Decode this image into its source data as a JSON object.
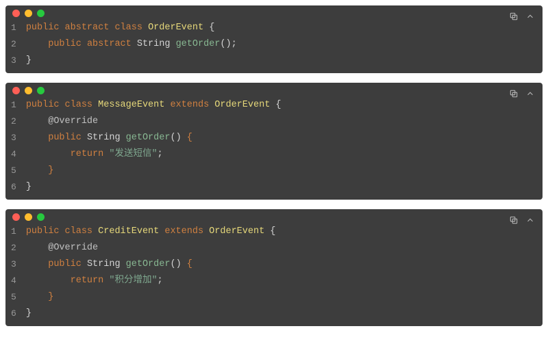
{
  "blocks": [
    {
      "id": "block-order-event",
      "lines": [
        [
          {
            "t": "public ",
            "c": "tok-key"
          },
          {
            "t": "abstract ",
            "c": "tok-key"
          },
          {
            "t": "class ",
            "c": "tok-key"
          },
          {
            "t": "OrderEvent ",
            "c": "tok-type"
          },
          {
            "t": "{",
            "c": "tok-punc"
          }
        ],
        [
          {
            "t": "    ",
            "c": ""
          },
          {
            "t": "public ",
            "c": "tok-key"
          },
          {
            "t": "abstract ",
            "c": "tok-key"
          },
          {
            "t": "String ",
            "c": "tok-punc"
          },
          {
            "t": "getOrder",
            "c": "tok-fn"
          },
          {
            "t": "();",
            "c": "tok-punc"
          }
        ],
        [
          {
            "t": "}",
            "c": "tok-punc"
          }
        ]
      ]
    },
    {
      "id": "block-message-event",
      "lines": [
        [
          {
            "t": "public ",
            "c": "tok-key"
          },
          {
            "t": "class ",
            "c": "tok-key"
          },
          {
            "t": "MessageEvent ",
            "c": "tok-type"
          },
          {
            "t": "extends ",
            "c": "tok-key"
          },
          {
            "t": "OrderEvent ",
            "c": "tok-type"
          },
          {
            "t": "{",
            "c": "tok-punc"
          }
        ],
        [
          {
            "t": "    ",
            "c": ""
          },
          {
            "t": "@Override",
            "c": "tok-anno"
          }
        ],
        [
          {
            "t": "    ",
            "c": ""
          },
          {
            "t": "public ",
            "c": "tok-key"
          },
          {
            "t": "String ",
            "c": "tok-punc"
          },
          {
            "t": "getOrder",
            "c": "tok-fn"
          },
          {
            "t": "() ",
            "c": "tok-punc"
          },
          {
            "t": "{",
            "c": "tok-brace"
          }
        ],
        [
          {
            "t": "        ",
            "c": ""
          },
          {
            "t": "return ",
            "c": "tok-key"
          },
          {
            "t": "\"发送短信\"",
            "c": "tok-str"
          },
          {
            "t": ";",
            "c": "tok-punc"
          }
        ],
        [
          {
            "t": "    ",
            "c": ""
          },
          {
            "t": "}",
            "c": "tok-brace"
          }
        ],
        [
          {
            "t": "}",
            "c": "tok-punc"
          }
        ]
      ]
    },
    {
      "id": "block-credit-event",
      "lines": [
        [
          {
            "t": "public ",
            "c": "tok-key"
          },
          {
            "t": "class ",
            "c": "tok-key"
          },
          {
            "t": "CreditEvent ",
            "c": "tok-type"
          },
          {
            "t": "extends ",
            "c": "tok-key"
          },
          {
            "t": "OrderEvent ",
            "c": "tok-type"
          },
          {
            "t": "{",
            "c": "tok-punc"
          }
        ],
        [
          {
            "t": "    ",
            "c": ""
          },
          {
            "t": "@Override",
            "c": "tok-anno"
          }
        ],
        [
          {
            "t": "    ",
            "c": ""
          },
          {
            "t": "public ",
            "c": "tok-key"
          },
          {
            "t": "String ",
            "c": "tok-punc"
          },
          {
            "t": "getOrder",
            "c": "tok-fn"
          },
          {
            "t": "() ",
            "c": "tok-punc"
          },
          {
            "t": "{",
            "c": "tok-brace"
          }
        ],
        [
          {
            "t": "        ",
            "c": ""
          },
          {
            "t": "return ",
            "c": "tok-key"
          },
          {
            "t": "\"积分增加\"",
            "c": "tok-str"
          },
          {
            "t": ";",
            "c": "tok-punc"
          }
        ],
        [
          {
            "t": "    ",
            "c": ""
          },
          {
            "t": "}",
            "c": "tok-brace"
          }
        ],
        [
          {
            "t": "}",
            "c": "tok-punc"
          }
        ]
      ]
    }
  ]
}
